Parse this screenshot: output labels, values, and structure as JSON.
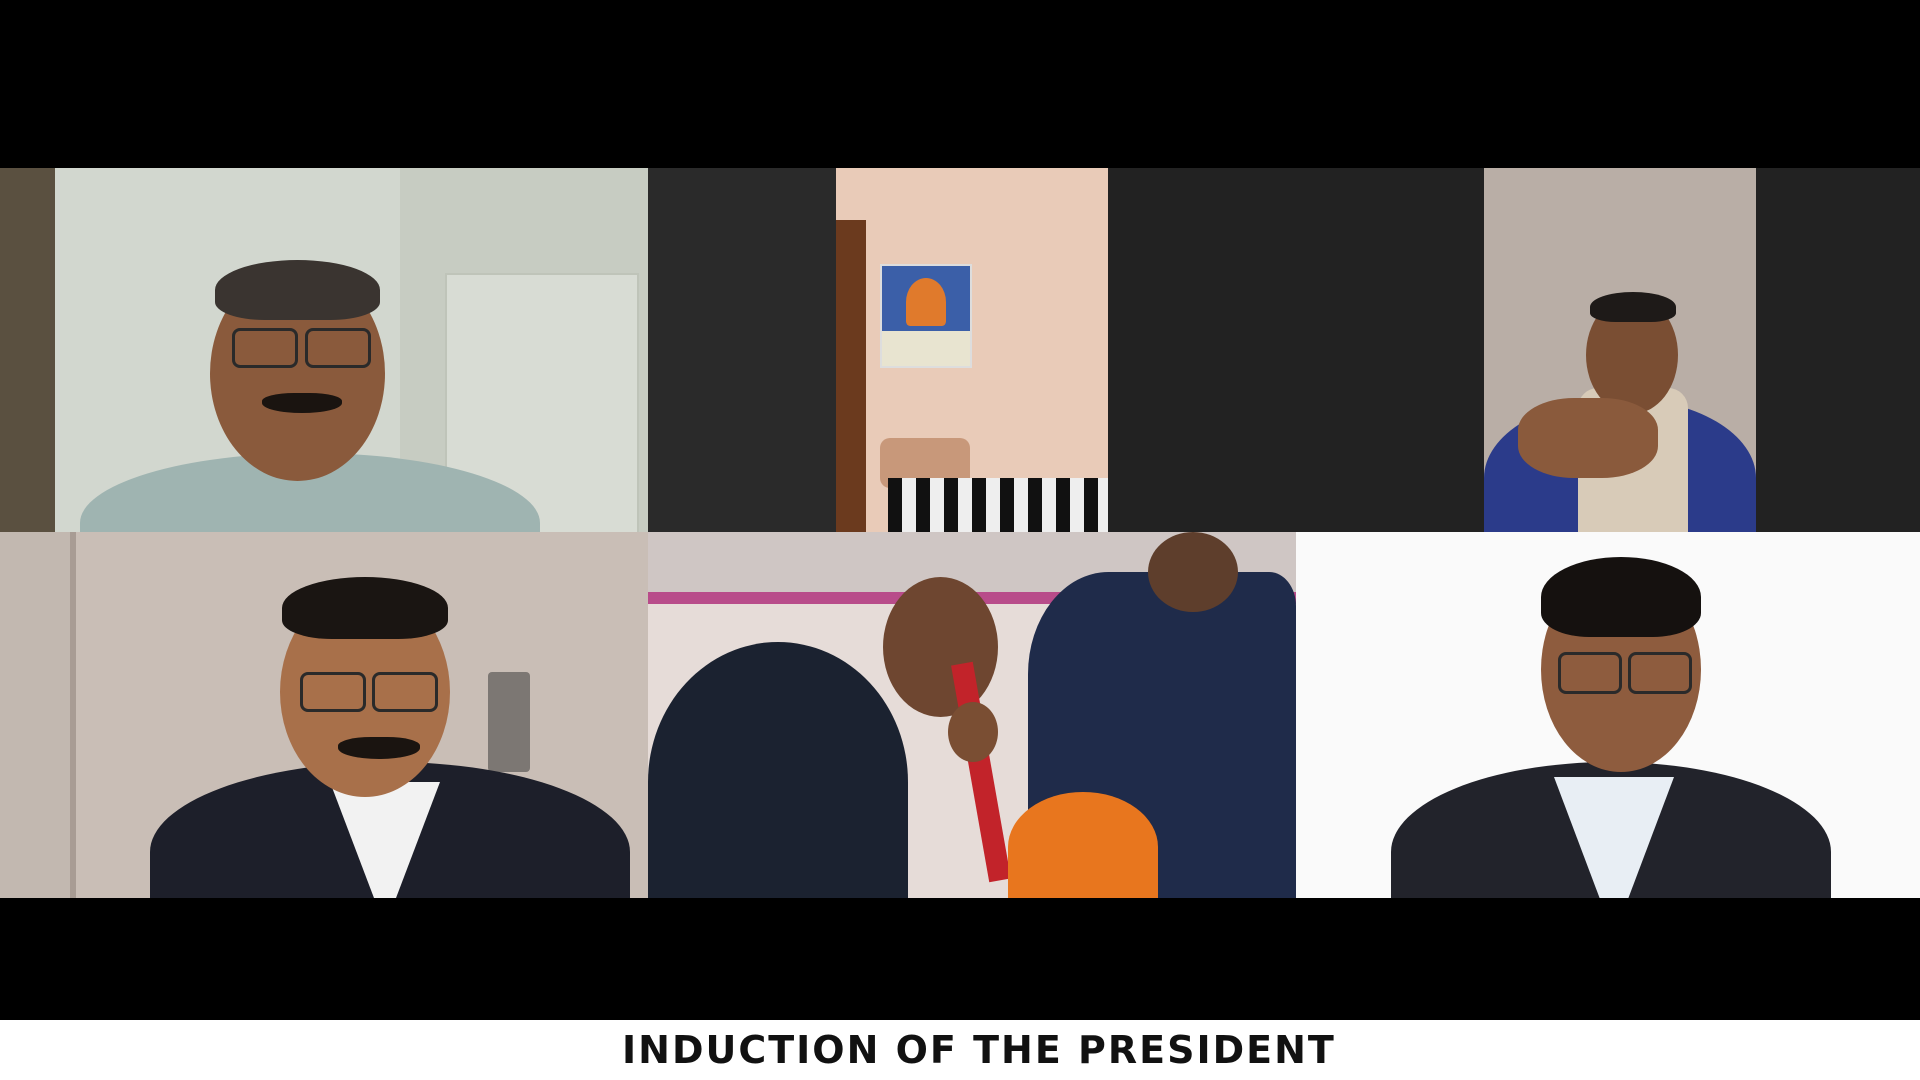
{
  "caption": "INDUCTION OF THE PRESIDENT",
  "colors": {
    "background": "#000000",
    "grid_background": "#222222",
    "caption_bar": "#ffffff",
    "caption_text": "#111111"
  },
  "tiles": [
    {
      "id": "participant-1",
      "icon": "video-participant"
    },
    {
      "id": "participant-2",
      "icon": "video-participant"
    },
    {
      "id": "participant-3",
      "icon": "video-participant"
    },
    {
      "id": "participant-4",
      "icon": "video-participant"
    },
    {
      "id": "participant-5",
      "icon": "video-participant"
    },
    {
      "id": "participant-6",
      "icon": "video-participant"
    }
  ]
}
